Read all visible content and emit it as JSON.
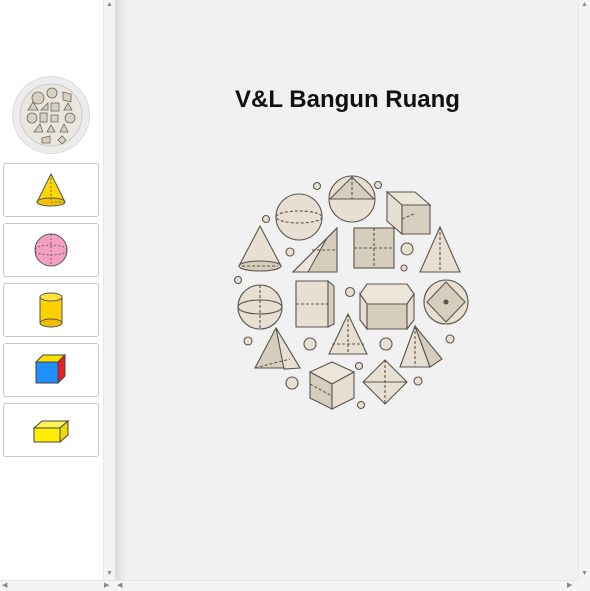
{
  "slide": {
    "title": "V&L Bangun Ruang"
  },
  "thumbnails": [
    {
      "name": "title-slide",
      "icon": "geometric-shapes-circle-icon"
    },
    {
      "name": "cone",
      "icon": "cone-icon",
      "color": "#ffd700"
    },
    {
      "name": "sphere",
      "icon": "sphere-icon",
      "color": "#f4a0c0"
    },
    {
      "name": "cylinder",
      "icon": "cylinder-icon",
      "color": "#ffd000"
    },
    {
      "name": "cube",
      "icon": "cube-icon",
      "colors": [
        "#e82020",
        "#1e90ff",
        "#ffe000"
      ]
    },
    {
      "name": "cuboid",
      "icon": "cuboid-icon",
      "color": "#ffee00"
    }
  ],
  "colors": {
    "shape_fill": "#e6dfd2",
    "shape_shade": "#cfc4b2",
    "shape_stroke": "#5a5550"
  }
}
